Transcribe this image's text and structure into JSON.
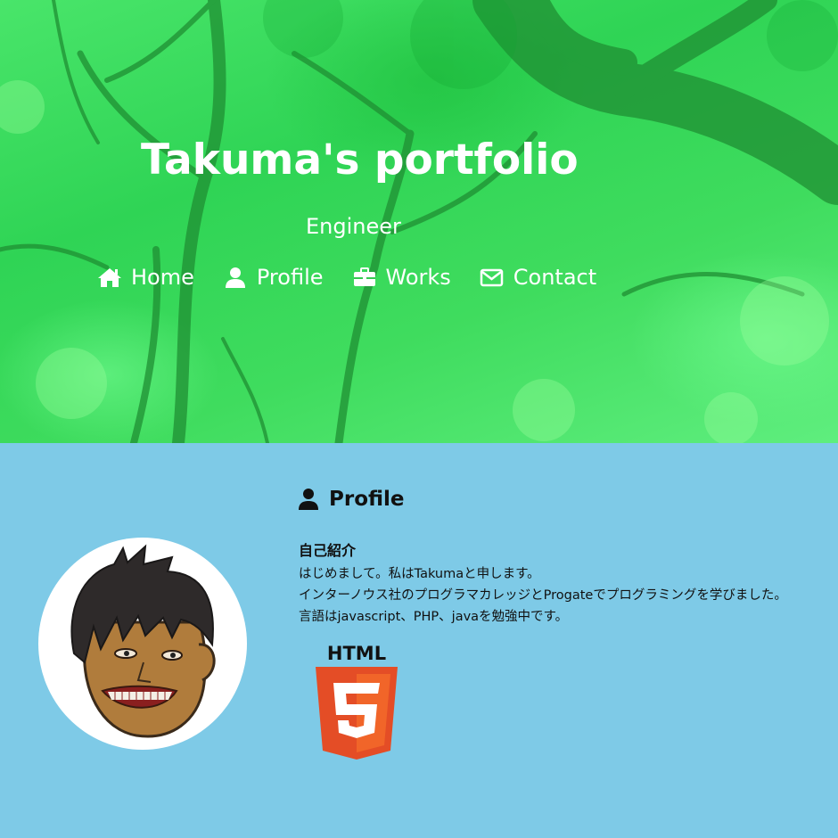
{
  "header": {
    "title": "Takuma's portfolio",
    "subtitle": "Engineer",
    "nav": [
      {
        "label": "Home",
        "icon": "home-icon"
      },
      {
        "label": "Profile",
        "icon": "user-icon"
      },
      {
        "label": "Works",
        "icon": "briefcase-icon"
      },
      {
        "label": "Contact",
        "icon": "envelope-icon"
      }
    ]
  },
  "profile": {
    "heading": "Profile",
    "heading_icon": "user-icon",
    "intro_title": "自己紹介",
    "intro_lines": [
      "はじめまして。私はTakumaと申します。",
      "インターノウス社のプログラマカレッジとProgateでプログラミングを学びました。",
      "言語はjavascript、PHP、javaを勉強中です。"
    ],
    "skill_logo": {
      "label": "HTML",
      "number": "5"
    }
  },
  "colors": {
    "hero_green": "#3fdc5e",
    "section_bg": "#7ecae7",
    "html5_orange": "#e44d26"
  }
}
